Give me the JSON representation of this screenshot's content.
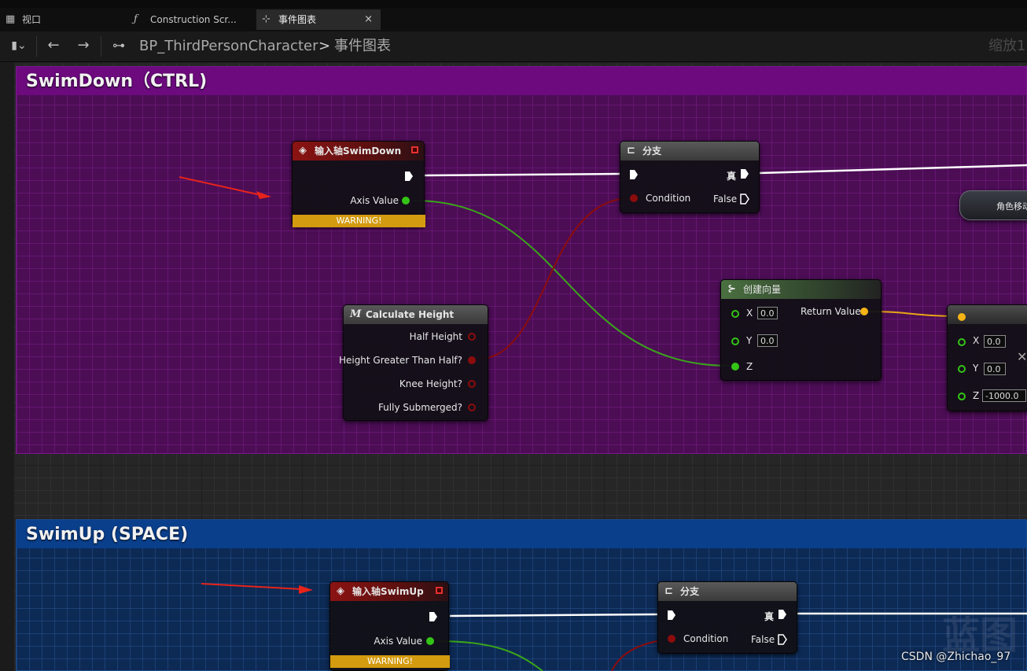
{
  "tabs": [
    {
      "label": "视口",
      "icon": "grid-icon"
    },
    {
      "label": "Construction Scr...",
      "icon": "function-icon"
    },
    {
      "label": "事件图表",
      "icon": "graph-icon",
      "active": true,
      "close": "×"
    }
  ],
  "toolbar": {
    "bookmark_icon": "bookmark-icon",
    "back": "←",
    "forward": "→",
    "breadcrumb_root": "BP_ThirdPersonCharacter",
    "breadcrumb_sep": ">",
    "breadcrumb_leaf": "事件图表",
    "zoom": "缩放1"
  },
  "comments": {
    "swimdown": "SwimDown（CTRL)",
    "swimup": "SwimUp (SPACE)"
  },
  "nodes": {
    "input_down": {
      "title": "输入轴SwimDown",
      "axis": "Axis Value",
      "warning": "WARNING!"
    },
    "branch_down": {
      "title": "分支",
      "condition": "Condition",
      "true": "真",
      "false": "False"
    },
    "calc_height": {
      "title": "Calculate Height",
      "out1": "Half Height",
      "out2": "Height Greater Than Half?",
      "out3": "Knee Height?",
      "out4": "Fully Submerged?"
    },
    "make_vector": {
      "title": "创建向量",
      "x": "X",
      "x_val": "0.0",
      "y": "Y",
      "y_val": "0.0",
      "z": "Z",
      "ret": "Return Value"
    },
    "vector2": {
      "x": "X",
      "x_val": "0.0",
      "y": "Y",
      "y_val": "0.0",
      "z": "Z",
      "z_val": "-1000.0"
    },
    "char_move": {
      "title": "角色移动"
    },
    "input_up": {
      "title": "输入轴SwimUp",
      "axis": "Axis Value",
      "warning": "WARNING!"
    },
    "branch_up": {
      "title": "分支",
      "condition": "Condition",
      "true": "真",
      "false": "False"
    }
  },
  "watermark": {
    "text": "蓝图",
    "csdn": "CSDN @Zhichao_97"
  },
  "colors": {
    "exec": "#ffffff",
    "float": "#34c416",
    "bool": "#8c0c0c",
    "vector": "#f5b416"
  }
}
